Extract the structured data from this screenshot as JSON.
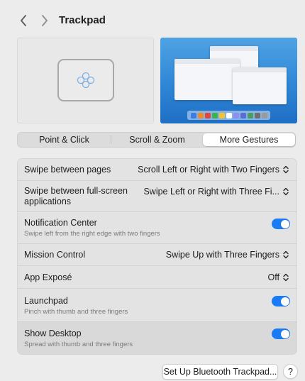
{
  "toolbar": {
    "title": "Trackpad",
    "back_icon": "chevron-left-icon",
    "forward_icon": "chevron-right-icon"
  },
  "tabs": [
    {
      "label": "Point & Click",
      "selected": false
    },
    {
      "label": "Scroll & Zoom",
      "selected": false
    },
    {
      "label": "More Gestures",
      "selected": true
    }
  ],
  "rows": {
    "swipe_pages": {
      "title": "Swipe between pages",
      "value": "Scroll Left or Right with Two Fingers"
    },
    "swipe_fullscreen": {
      "title_line1": "Swipe between full-screen",
      "title_line2": "applications",
      "value": "Swipe Left or Right with Three Fi..."
    },
    "notification_center": {
      "title": "Notification Center",
      "subtitle": "Swipe left from the right edge with two fingers",
      "enabled": true
    },
    "mission_control": {
      "title": "Mission Control",
      "value": "Swipe Up with Three Fingers"
    },
    "app_expose": {
      "title": "App Exposé",
      "value": "Off"
    },
    "launchpad": {
      "title": "Launchpad",
      "subtitle": "Pinch with thumb and three fingers",
      "enabled": true
    },
    "show_desktop": {
      "title": "Show Desktop",
      "subtitle": "Spread with thumb and three fingers",
      "enabled": true
    }
  },
  "footer": {
    "bluetooth_button": "Set Up Bluetooth Trackpad...",
    "help_button": "?"
  },
  "colors": {
    "accent": "#1a7cf5",
    "window_bg": "#ececec",
    "wallpaper_top": "#4fa3e3",
    "wallpaper_bottom": "#1f6fc4"
  }
}
